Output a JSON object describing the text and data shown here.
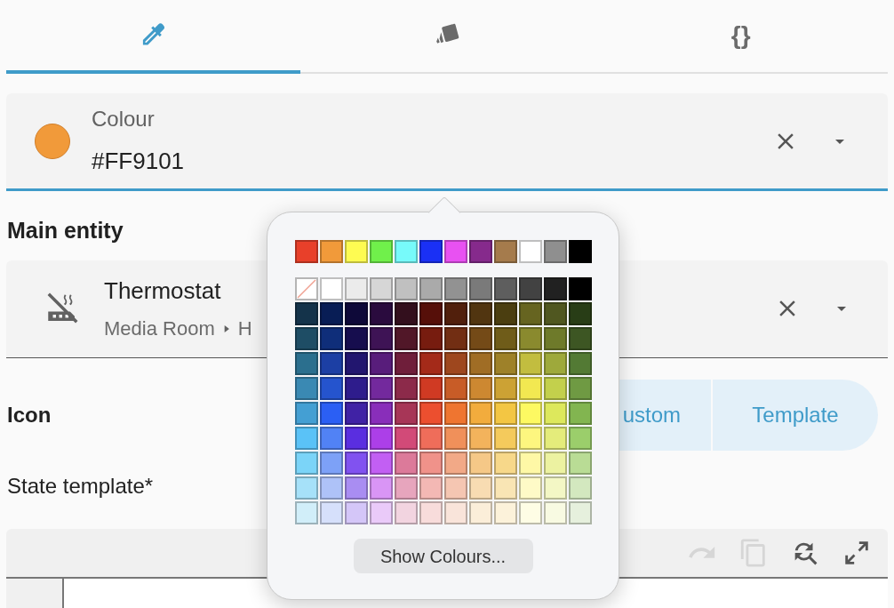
{
  "tabs": [
    {
      "selected": true
    },
    {
      "selected": false
    },
    {
      "text": "{}",
      "selected": false
    }
  ],
  "colour_field": {
    "label": "Colour",
    "value": "#FF9101",
    "color": "#f19a3a",
    "focused": true
  },
  "main_entity": {
    "label": "Main entity",
    "name": "Thermostat",
    "breadcrumb": [
      "Media Room",
      "H"
    ]
  },
  "icon_row": {
    "label": "Icon",
    "segments": [
      {
        "label": "ustom",
        "selected": false
      },
      {
        "label": "Template",
        "selected": false
      }
    ]
  },
  "state_template": {
    "label": "State template*",
    "toolbar": [
      {
        "disabled": true
      },
      {
        "disabled": true
      },
      {
        "disabled": false
      },
      {
        "disabled": false
      }
    ]
  },
  "colour_picker": {
    "top_row": [
      {
        "color": "#e8402a"
      },
      {
        "color": "#f19a3a"
      },
      {
        "color": "#fefb52"
      },
      {
        "color": "#70f04b"
      },
      {
        "color": "#77fafa"
      },
      {
        "color": "#1a30f5"
      },
      {
        "color": "#e851f2"
      },
      {
        "color": "#862a8c"
      },
      {
        "color": "#a57b4c"
      },
      {
        "color": "#ffffff"
      },
      {
        "color": "#8f8f8f"
      },
      {
        "color": "#000000"
      }
    ],
    "grid": [
      [
        {
          "kind": "none"
        },
        {
          "color": "#ffffff"
        },
        {
          "color": "#ebebeb"
        },
        {
          "color": "#d6d6d6"
        },
        {
          "color": "#c0c0c0"
        },
        {
          "color": "#aaaaaa"
        },
        {
          "color": "#929292"
        },
        {
          "color": "#7a7a7a"
        },
        {
          "color": "#5e5e5e"
        },
        {
          "color": "#424242"
        },
        {
          "color": "#212121"
        },
        {
          "color": "#000000"
        }
      ],
      [
        {
          "color": "#14334a"
        },
        {
          "color": "#081d55"
        },
        {
          "color": "#0e0939"
        },
        {
          "color": "#2a0b3e"
        },
        {
          "color": "#330f1d"
        },
        {
          "color": "#560f09"
        },
        {
          "color": "#511f0c"
        },
        {
          "color": "#513510"
        },
        {
          "color": "#4b3e10"
        },
        {
          "color": "#666420"
        },
        {
          "color": "#505720"
        },
        {
          "color": "#283d16"
        }
      ],
      [
        {
          "color": "#1e4d65"
        },
        {
          "color": "#0f2e7a"
        },
        {
          "color": "#160d4e"
        },
        {
          "color": "#3e1355"
        },
        {
          "color": "#511728"
        },
        {
          "color": "#771c0f"
        },
        {
          "color": "#722e13"
        },
        {
          "color": "#744a17"
        },
        {
          "color": "#6f5c19"
        },
        {
          "color": "#8a8a2e"
        },
        {
          "color": "#6e7a2a"
        },
        {
          "color": "#3d5623"
        }
      ],
      [
        {
          "color": "#2b6f8e"
        },
        {
          "color": "#1c3fa4"
        },
        {
          "color": "#22166f"
        },
        {
          "color": "#581d7b"
        },
        {
          "color": "#6f1e3a"
        },
        {
          "color": "#a42a19"
        },
        {
          "color": "#9e471e"
        },
        {
          "color": "#a06d25"
        },
        {
          "color": "#9e8129"
        },
        {
          "color": "#c2bd3f"
        },
        {
          "color": "#9ea93b"
        },
        {
          "color": "#537a34"
        }
      ],
      [
        {
          "color": "#3a89b3"
        },
        {
          "color": "#2554ce"
        },
        {
          "color": "#2e1c8c"
        },
        {
          "color": "#73299d"
        },
        {
          "color": "#8c2a4a"
        },
        {
          "color": "#d03a23"
        },
        {
          "color": "#c85c27"
        },
        {
          "color": "#cd8831"
        },
        {
          "color": "#cca234"
        },
        {
          "color": "#f2e851"
        },
        {
          "color": "#c3d04c"
        },
        {
          "color": "#6f9a43"
        }
      ],
      [
        {
          "color": "#449fd3"
        },
        {
          "color": "#2b5ff4"
        },
        {
          "color": "#4022a5"
        },
        {
          "color": "#892eba"
        },
        {
          "color": "#a73657"
        },
        {
          "color": "#ec4f2f"
        },
        {
          "color": "#ef7530"
        },
        {
          "color": "#f2ac3d"
        },
        {
          "color": "#f3c643"
        },
        {
          "color": "#fdf962"
        },
        {
          "color": "#dde85c"
        },
        {
          "color": "#82b550"
        }
      ],
      [
        {
          "color": "#5ac2f7"
        },
        {
          "color": "#5182f5"
        },
        {
          "color": "#5a2ee0"
        },
        {
          "color": "#ac3fe8"
        },
        {
          "color": "#d24a78"
        },
        {
          "color": "#ef6d5a"
        },
        {
          "color": "#f0905a"
        },
        {
          "color": "#f3b35c"
        },
        {
          "color": "#f4ca5c"
        },
        {
          "color": "#fdf67f"
        },
        {
          "color": "#e4ec7b"
        },
        {
          "color": "#9bce6b"
        }
      ],
      [
        {
          "color": "#7bd4f8"
        },
        {
          "color": "#7da1f7"
        },
        {
          "color": "#8152f0"
        },
        {
          "color": "#c25ff3"
        },
        {
          "color": "#dc7a9a"
        },
        {
          "color": "#f0928a"
        },
        {
          "color": "#f2a987"
        },
        {
          "color": "#f5c887"
        },
        {
          "color": "#f7d88a"
        },
        {
          "color": "#fef8a6"
        },
        {
          "color": "#ecf2a1"
        },
        {
          "color": "#b9dc95"
        }
      ],
      [
        {
          "color": "#a6e1f9"
        },
        {
          "color": "#aec2f8"
        },
        {
          "color": "#a98df2"
        },
        {
          "color": "#d995f5"
        },
        {
          "color": "#e7a5bd"
        },
        {
          "color": "#f3b8b4"
        },
        {
          "color": "#f5c6b2"
        },
        {
          "color": "#f8dcb2"
        },
        {
          "color": "#f9e5b4"
        },
        {
          "color": "#fefac7"
        },
        {
          "color": "#f3f7c5"
        },
        {
          "color": "#d3e8bf"
        }
      ],
      [
        {
          "color": "#d1eef9"
        },
        {
          "color": "#d6e0fb"
        },
        {
          "color": "#d4c6f8"
        },
        {
          "color": "#eacaf9"
        },
        {
          "color": "#f2d4e0"
        },
        {
          "color": "#f8dcdb"
        },
        {
          "color": "#f9e4da"
        },
        {
          "color": "#fbeed9"
        },
        {
          "color": "#fcf2da"
        },
        {
          "color": "#fefde5"
        },
        {
          "color": "#f8fae2"
        },
        {
          "color": "#e6f0dd"
        }
      ]
    ],
    "button": "Show Colours..."
  }
}
